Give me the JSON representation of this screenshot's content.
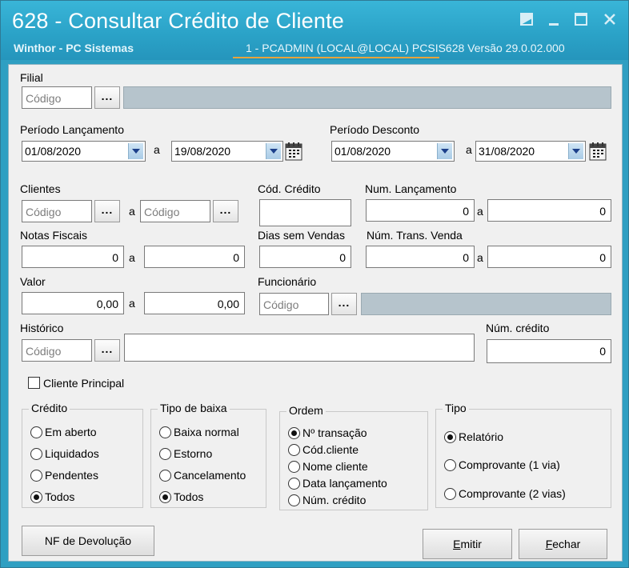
{
  "window": {
    "title": "628 - Consultar Crédito de Cliente",
    "subtitle": "Winthor - PC Sistemas",
    "status": "1 - PCADMIN (LOCAL@LOCAL)   PCSIS628  Versão  29.0.02.000",
    "icons": [
      "restore-icon",
      "minimize-icon",
      "maximize-icon",
      "close-icon"
    ]
  },
  "filial": {
    "label": "Filial",
    "placeholder": "Código",
    "browse": "..."
  },
  "periodo_lancamento": {
    "label": "Período Lançamento",
    "from": "01/08/2020",
    "sep": "a",
    "to": "19/08/2020"
  },
  "periodo_desconto": {
    "label": "Período Desconto",
    "from": "01/08/2020",
    "sep": "a",
    "to": "31/08/2020"
  },
  "clientes": {
    "label": "Clientes",
    "placeholder_from": "Código",
    "placeholder_to": "Código",
    "sep": "a",
    "browse": "..."
  },
  "cod_credito": {
    "label": "Cód. Crédito",
    "value": ""
  },
  "num_lancamento": {
    "label": "Num. Lançamento",
    "from": "0",
    "sep": "a",
    "to": "0"
  },
  "notas_fiscais": {
    "label": "Notas Fiscais",
    "from": "0",
    "sep": "a",
    "to": "0"
  },
  "dias_sem_vendas": {
    "label": "Dias sem Vendas",
    "value": "0"
  },
  "num_trans_venda": {
    "label": "Núm. Trans. Venda",
    "from": "0",
    "sep": "a",
    "to": "0"
  },
  "valor": {
    "label": "Valor",
    "from": "0,00",
    "sep": "a",
    "to": "0,00"
  },
  "funcionario": {
    "label": "Funcionário",
    "placeholder": "Código",
    "browse": "..."
  },
  "historico": {
    "label": "Histórico",
    "placeholder": "Código",
    "browse": "...",
    "text": ""
  },
  "num_credito": {
    "label": "Núm. crédito",
    "value": "0"
  },
  "cliente_principal": {
    "label": "Cliente Principal",
    "checked": false
  },
  "credito": {
    "title": "Crédito",
    "options": [
      "Em aberto",
      "Liquidados",
      "Pendentes",
      "Todos"
    ],
    "selected": "Todos"
  },
  "tipo_baixa": {
    "title": "Tipo de baixa",
    "options": [
      "Baixa normal",
      "Estorno",
      "Cancelamento",
      "Todos"
    ],
    "selected": "Todos"
  },
  "ordem": {
    "title": "Ordem",
    "options": [
      "Nº transação",
      "Cód.cliente",
      "Nome cliente",
      "Data lançamento",
      "Núm. crédito"
    ],
    "selected": "Nº transação"
  },
  "tipo": {
    "title": "Tipo",
    "options": [
      "Relatório",
      "Comprovante (1 via)",
      "Comprovante (2 vias)"
    ],
    "selected": "Relatório"
  },
  "buttons": {
    "nf_devolucao": "NF de Devolução",
    "emitir": {
      "accel": "E",
      "rest": "mitir"
    },
    "fechar": {
      "accel": "F",
      "rest": "echar"
    }
  }
}
